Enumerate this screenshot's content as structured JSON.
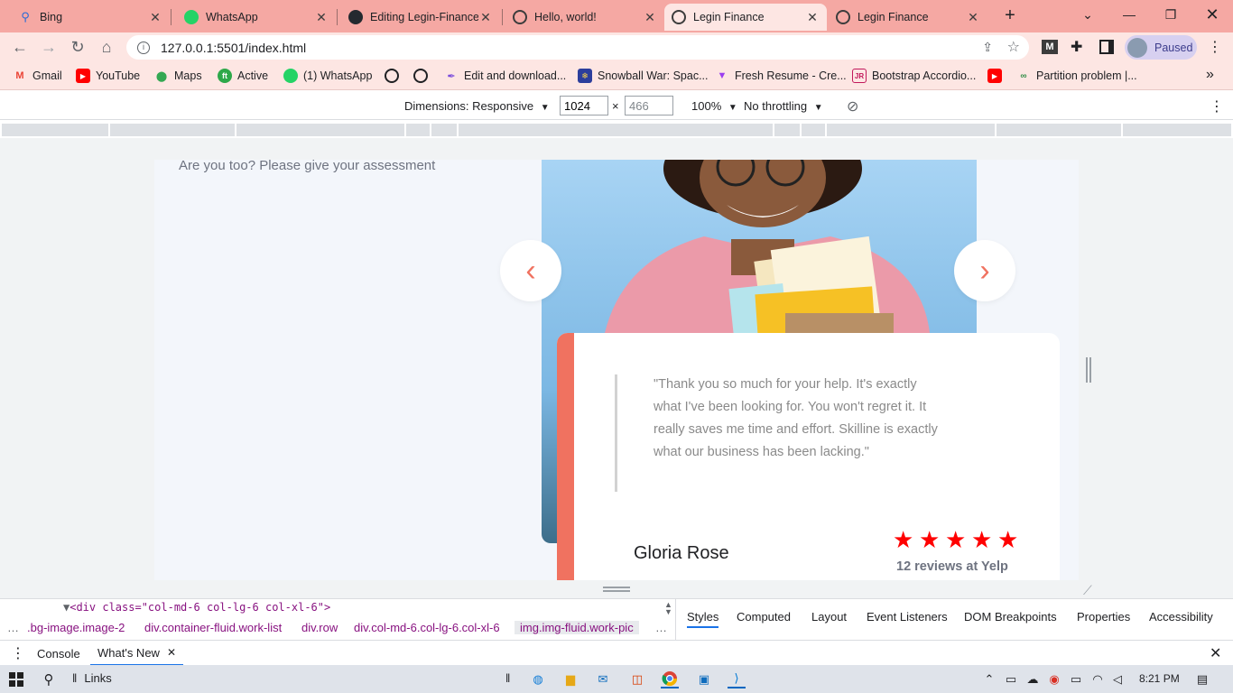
{
  "tabs": [
    {
      "title": "Bing",
      "icon": "bing-icon",
      "active": false
    },
    {
      "title": "WhatsApp",
      "icon": "whatsapp-icon",
      "active": false
    },
    {
      "title": "Editing Legin-Finance",
      "icon": "github-icon",
      "active": false
    },
    {
      "title": "Hello, world!",
      "icon": "globe-icon",
      "active": false
    },
    {
      "title": "Legin Finance",
      "icon": "globe-icon",
      "active": true
    },
    {
      "title": "Legin Finance",
      "icon": "globe-icon",
      "active": false
    }
  ],
  "toolbar": {
    "url": "127.0.0.1:5501/index.html",
    "profile_label": "Paused"
  },
  "bookmarks": [
    {
      "label": "Gmail",
      "icon": "gmail-icon"
    },
    {
      "label": "YouTube",
      "icon": "youtube-icon"
    },
    {
      "label": "Maps",
      "icon": "maps-icon"
    },
    {
      "label": "Active",
      "icon": "active-icon"
    },
    {
      "label": "(1) WhatsApp",
      "icon": "whatsapp-icon"
    },
    {
      "label": "",
      "icon": "globe-icon"
    },
    {
      "label": "",
      "icon": "globe-icon"
    },
    {
      "label": "Edit and download...",
      "icon": "feather-icon"
    },
    {
      "label": "Snowball War: Spac...",
      "icon": "snowball-icon"
    },
    {
      "label": "Fresh Resume - Cre...",
      "icon": "resume-icon"
    },
    {
      "label": "Bootstrap Accordio...",
      "icon": "jr-icon"
    },
    {
      "label": "",
      "icon": "youtube-icon"
    },
    {
      "label": "Partition problem |...",
      "icon": "gfg-icon"
    }
  ],
  "devbar": {
    "dimensions_label": "Dimensions: Responsive",
    "width_value": "1024",
    "height_value": "466",
    "times": "×",
    "zoom": "100%",
    "throttle": "No throttling"
  },
  "page": {
    "assessment_text": "Are you too? Please give your assessment",
    "quote": "\"Thank you so much for your help. It's exactly what I've been looking for. You won't regret it. It really saves me time and effort. Skilline is exactly what our business has been lacking.\"",
    "author": "Gloria Rose",
    "rating": 5,
    "reviews_text": "12 reviews at Yelp",
    "prev_symbol": "‹",
    "next_symbol": "›",
    "accent_color": "#f07260",
    "star_color": "#ff0000"
  },
  "devtools": {
    "dom_line": "<div class=\"col-md-6 col-lg-6 col-xl-6\">",
    "breadcrumbs": [
      ".bg-image.image-2",
      "div.container-fluid.work-list",
      "div.row",
      "div.col-md-6.col-lg-6.col-xl-6",
      "img.img-fluid.work-pic"
    ],
    "panel_tabs": [
      "Styles",
      "Computed",
      "Layout",
      "Event Listeners",
      "DOM Breakpoints",
      "Properties",
      "Accessibility"
    ],
    "drawer_tabs": [
      "Console",
      "What's New"
    ]
  },
  "taskbar": {
    "search_label": "Links",
    "time": "8:21 PM"
  }
}
